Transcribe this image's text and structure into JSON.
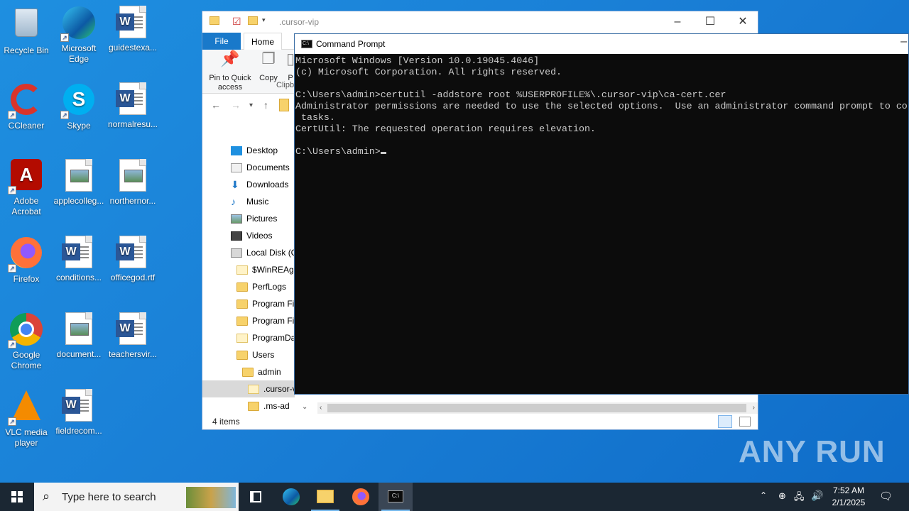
{
  "desktop": {
    "icons": [
      {
        "label": "Recycle Bin"
      },
      {
        "label": "Microsoft Edge"
      },
      {
        "label": "guidestexa..."
      },
      {
        "label": "CCleaner"
      },
      {
        "label": "Skype"
      },
      {
        "label": "normalresu..."
      },
      {
        "label": "Adobe Acrobat"
      },
      {
        "label": "applecolleg..."
      },
      {
        "label": "northernor..."
      },
      {
        "label": "Firefox"
      },
      {
        "label": "conditions..."
      },
      {
        "label": "officegod.rtf"
      },
      {
        "label": "Google Chrome"
      },
      {
        "label": "document..."
      },
      {
        "label": "teachersvir..."
      },
      {
        "label": "VLC media player"
      },
      {
        "label": "fieldrecom..."
      }
    ]
  },
  "explorer": {
    "title": ".cursor-vip",
    "tabs": {
      "file": "File",
      "home": "Home"
    },
    "ribbon": {
      "pin": "Pin to Quick access",
      "copy": "Copy",
      "paste": "P",
      "clipboard": "Clipb"
    },
    "tree": [
      {
        "label": "Desktop"
      },
      {
        "label": "Documents"
      },
      {
        "label": "Downloads"
      },
      {
        "label": "Music"
      },
      {
        "label": "Pictures"
      },
      {
        "label": "Videos"
      },
      {
        "label": "Local Disk (C"
      },
      {
        "label": "$WinREAge"
      },
      {
        "label": "PerfLogs"
      },
      {
        "label": "Program Fil"
      },
      {
        "label": "Program Fil"
      },
      {
        "label": "ProgramDat"
      },
      {
        "label": "Users"
      },
      {
        "label": "admin"
      },
      {
        "label": ".cursor-v"
      },
      {
        "label": ".ms-ad"
      }
    ],
    "status": "4 items"
  },
  "cmd": {
    "title": "Command Prompt",
    "lines": [
      "Microsoft Windows [Version 10.0.19045.4046]",
      "(c) Microsoft Corporation. All rights reserved.",
      "",
      "C:\\Users\\admin>certutil -addstore root %USERPROFILE%\\.cursor-vip\\ca-cert.cer",
      "Administrator permissions are needed to use the selected options.  Use an administrator command prompt to co",
      " tasks.",
      "CertUtil: The requested operation requires elevation.",
      "",
      "C:\\Users\\admin>"
    ]
  },
  "taskbar": {
    "search_placeholder": "Type here to search",
    "time": "7:52 AM",
    "date": "2/1/2025"
  },
  "watermark": "ANY RUN"
}
